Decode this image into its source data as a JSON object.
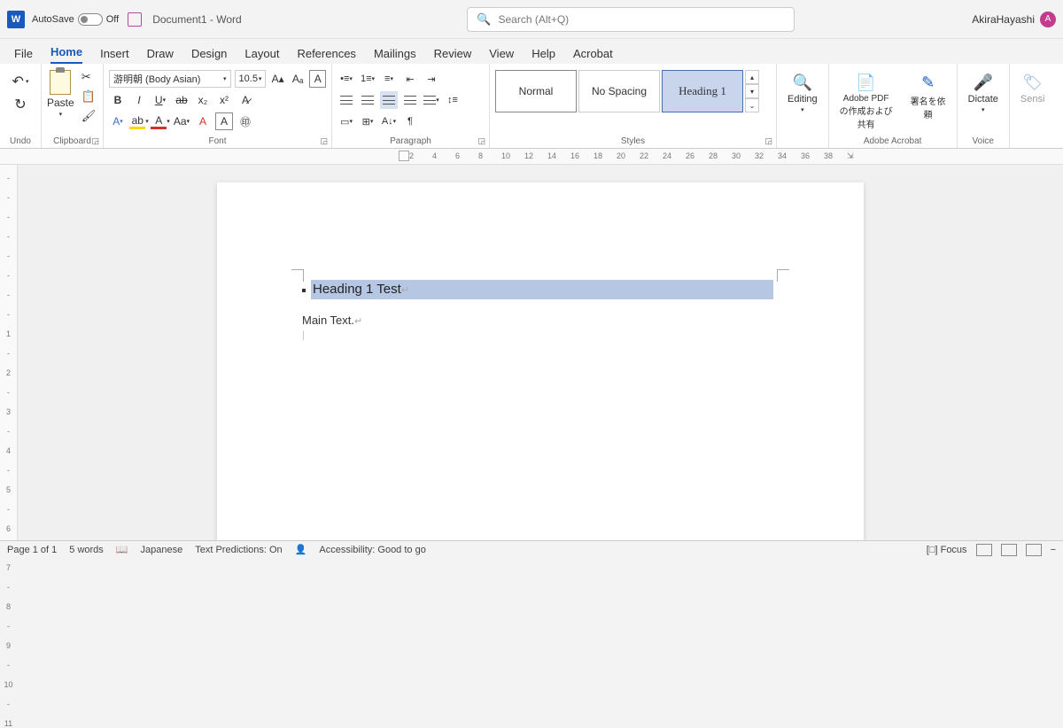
{
  "titlebar": {
    "autosave_label": "AutoSave",
    "autosave_state": "Off",
    "document_title": "Document1  -  Word",
    "search_placeholder": "Search (Alt+Q)",
    "user_name": "AkiraHayashi",
    "user_initial": "A"
  },
  "menus": {
    "file": "File",
    "home": "Home",
    "insert": "Insert",
    "draw": "Draw",
    "design": "Design",
    "layout": "Layout",
    "references": "References",
    "mailings": "Mailings",
    "review": "Review",
    "view": "View",
    "help": "Help",
    "acrobat": "Acrobat"
  },
  "ribbon": {
    "undo_label": "Undo",
    "clipboard_label": "Clipboard",
    "paste_label": "Paste",
    "font_label": "Font",
    "font_name": "游明朝 (Body Asian)",
    "font_size": "10.5",
    "paragraph_label": "Paragraph",
    "styles_label": "Styles",
    "style_normal": "Normal",
    "style_nospacing": "No Spacing",
    "style_heading1": "Heading 1",
    "editing_label": "Editing",
    "acrobat_label": "Adobe Acrobat",
    "acrobat_pdf": "Adobe PDF の作成および共有",
    "acrobat_sign": "署名を依頼",
    "voice_label": "Voice",
    "dictate_label": "Dictate",
    "sens_label": "Sensi"
  },
  "ruler": {
    "ticks": [
      "2",
      "4",
      "6",
      "8",
      "10",
      "12",
      "14",
      "16",
      "18",
      "20",
      "22",
      "24",
      "26",
      "28",
      "30",
      "32",
      "34",
      "36",
      "38"
    ]
  },
  "vruler": [
    "-",
    "-",
    "-",
    "-",
    "-",
    "-",
    "-",
    "-",
    "1",
    "-",
    "2",
    "-",
    "3",
    "-",
    "4",
    "-",
    "5",
    "-",
    "6",
    "-",
    "7",
    "-",
    "8",
    "-",
    "9",
    "-",
    "10",
    "-",
    "11"
  ],
  "document": {
    "heading_text": "Heading 1 Test",
    "main_text": "Main Text."
  },
  "statusbar": {
    "page": "Page 1 of 1",
    "words": "5 words",
    "language": "Japanese",
    "predictions": "Text Predictions: On",
    "accessibility": "Accessibility: Good to go",
    "focus": "Focus"
  }
}
